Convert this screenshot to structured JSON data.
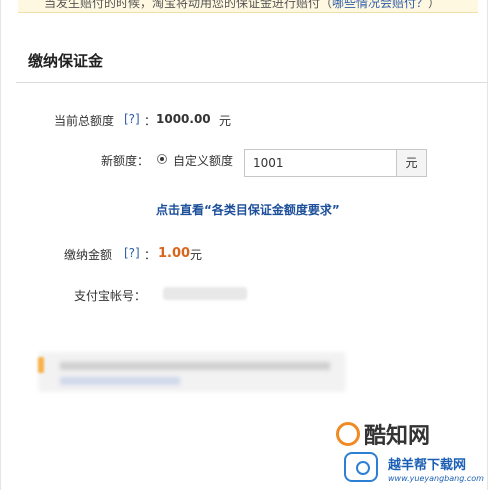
{
  "notice": {
    "text": "当发生赔付的时候，淘宝将动用您的保证金进行赔付（",
    "link": "哪些情况会赔付？",
    "close": "）"
  },
  "section": {
    "title": "缴纳保证金"
  },
  "form": {
    "total_quota": {
      "label": "当前总额度",
      "help": "[?]",
      "colon": "：",
      "value": "1000.00",
      "unit": "元"
    },
    "new_quota": {
      "label": "新额度：",
      "option_label": "自定义额度",
      "selected": true,
      "input_value": "1001",
      "unit": "元"
    },
    "requirements_link": "点击直看“各类目保证金额度要求”",
    "pay_amount": {
      "label": "缴纳金额",
      "help": "[?]",
      "colon": "：",
      "value": "1.00",
      "unit": "元"
    },
    "alipay_account": {
      "label": "支付宝帐号："
    }
  },
  "watermark": {
    "main": "酷知网",
    "sub": "越羊帮下载网",
    "url": "www.yueyangbang.com"
  },
  "colors": {
    "link": "#2f5ea8",
    "accent_orange": "#d9641c",
    "divider": "#dcdcdc"
  }
}
